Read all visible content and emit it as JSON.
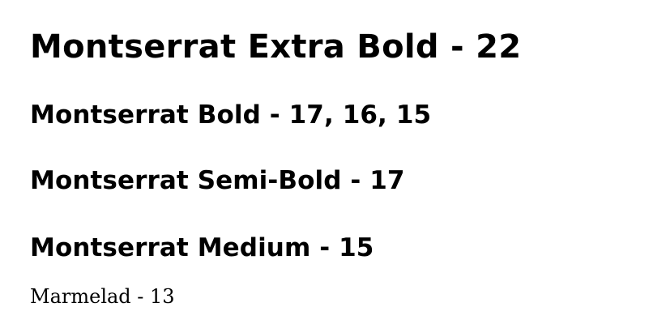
{
  "samples": [
    {
      "label": "Montserrat Extra Bold - 22"
    },
    {
      "label": "Montserrat Bold - 17, 16, 15"
    },
    {
      "label": "Montserrat Semi-Bold - 17"
    },
    {
      "label": "Montserrat Medium - 15"
    },
    {
      "label": "Marmelad - 13"
    }
  ],
  "colors": {
    "background": "#ffffff",
    "text": "#000000"
  }
}
